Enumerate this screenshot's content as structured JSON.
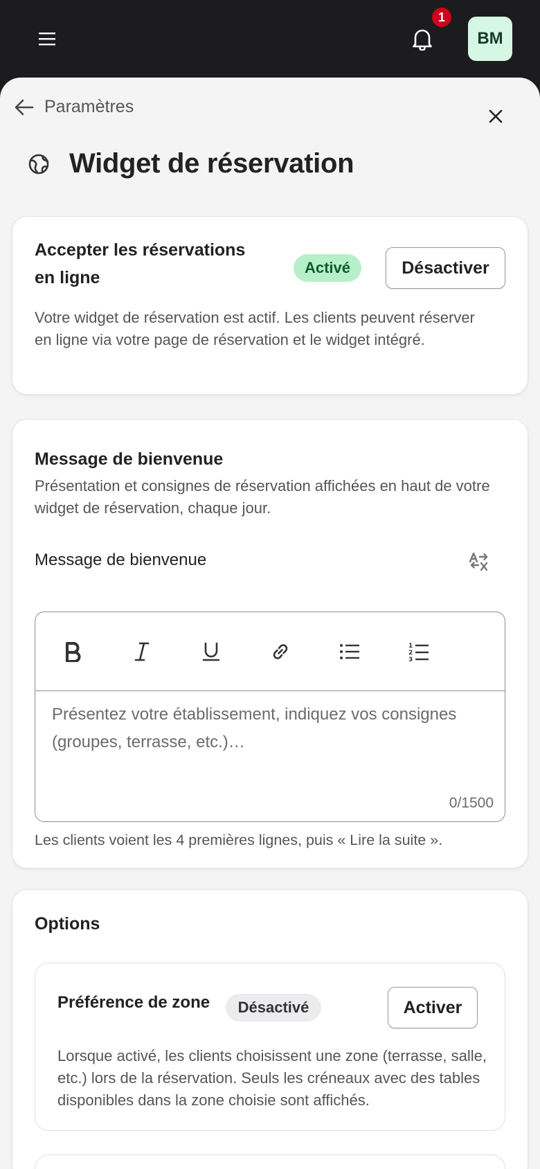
{
  "header": {
    "notification_count": "1",
    "avatar_initials": "BM"
  },
  "nav": {
    "back_label": "Paramètres"
  },
  "page": {
    "title": "Widget de réservation"
  },
  "online_booking": {
    "title": "Accepter les réservations en ligne",
    "status": "Activé",
    "action": "Désactiver",
    "description": "Votre widget de réservation est actif. Les clients peuvent réserver en ligne via votre page de réservation et le widget intégré."
  },
  "welcome": {
    "title": "Message de bienvenue",
    "description": "Présentation et consignes de réservation affichées en haut de votre widget de réservation, chaque jour.",
    "field_label": "Message de bienvenue",
    "placeholder": "Présentez votre établissement, indiquez vos consignes (groupes, terrasse, etc.)…",
    "counter": "0/1500",
    "helper": "Les clients voient les 4 premières lignes, puis « Lire la suite »."
  },
  "options": {
    "title": "Options",
    "zone": {
      "title": "Préférence de zone",
      "status": "Désactivé",
      "action": "Activer",
      "description": "Lorsque activé, les clients choisissent une zone (terrasse, salle, etc.) lors de la réservation. Seuls les créneaux avec des tables disponibles dans la zone choisie sont affichés."
    }
  },
  "colors": {
    "topbar": "#1c1c1e",
    "sheet": "#f4f4f5",
    "badge_active_bg": "#b7f0c8",
    "badge_inactive_bg": "#ececee",
    "notification": "#d0021b",
    "avatar_bg": "#d6f7e3"
  }
}
